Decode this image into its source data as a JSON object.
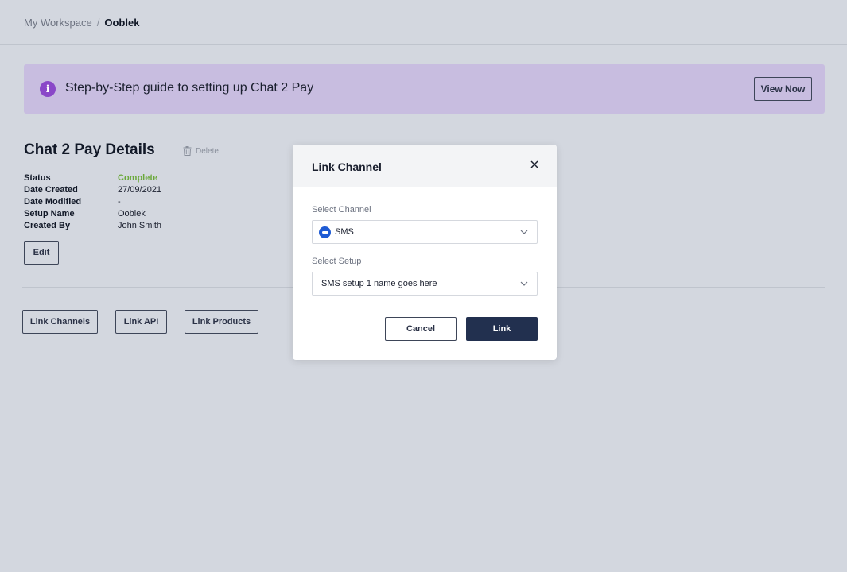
{
  "breadcrumb": {
    "workspace": "My Workspace",
    "separator": "/",
    "current": "Ooblek"
  },
  "banner": {
    "icon": "info-icon",
    "text": "Step-by-Step guide to setting up Chat 2 Pay",
    "button_label": "View Now"
  },
  "details": {
    "title": "Chat 2 Pay Details",
    "delete_label": "Delete",
    "rows": [
      {
        "label": "Status",
        "value": "Complete"
      },
      {
        "label": "Date Created",
        "value": "27/09/2021"
      },
      {
        "label": "Date Modified",
        "value": "-"
      },
      {
        "label": "Setup Name",
        "value": "Ooblek"
      },
      {
        "label": "Created By",
        "value": "John Smith"
      }
    ],
    "edit_label": "Edit"
  },
  "link_buttons": {
    "channels": "Link Channels",
    "api": "Link API",
    "products": "Link Products"
  },
  "modal": {
    "title": "Link Channel",
    "channel_label": "Select Channel",
    "channel_value": "SMS",
    "setup_label": "Select Setup",
    "setup_value": "SMS setup 1 name goes here",
    "cancel_label": "Cancel",
    "link_label": "Link"
  },
  "colors": {
    "background": "#d3d7df",
    "banner": "#c8bde0",
    "info_icon": "#8a48c8",
    "status_complete": "#6aa83a",
    "primary_button": "#22304f",
    "sms_icon": "#1e5bd4"
  }
}
